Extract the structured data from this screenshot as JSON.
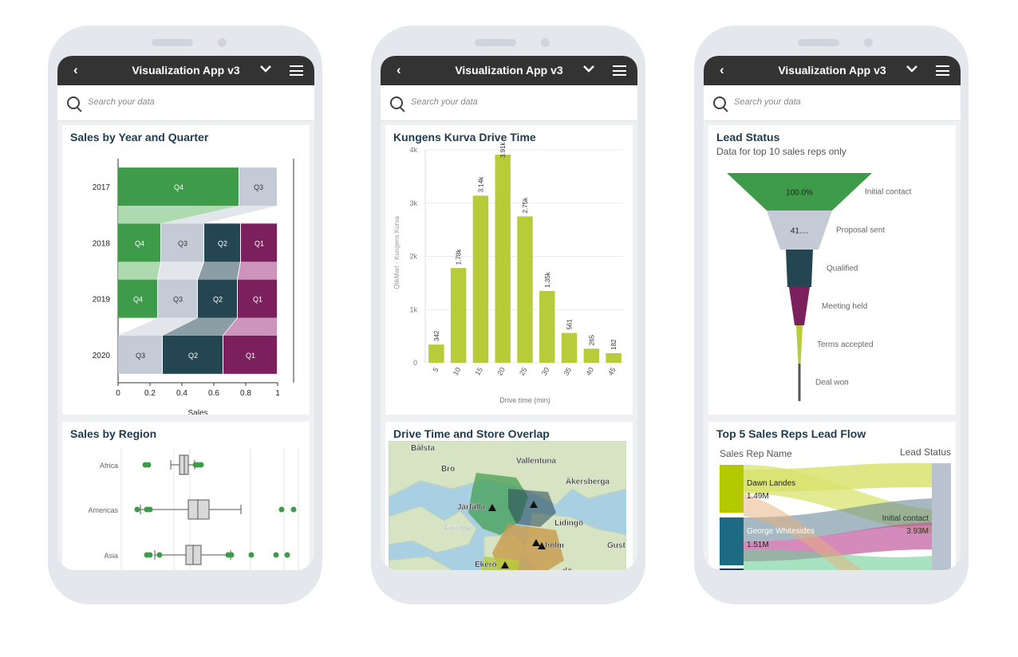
{
  "app": {
    "title": "Visualization App v3",
    "back_icon": "‹",
    "dropdown_icon": "⌄"
  },
  "search": {
    "placeholder": "Search your data"
  },
  "colors": {
    "green": "#3d9b49",
    "light_green": "#a5d6a7",
    "grey": "#c4cbd6",
    "navy": "#244653",
    "purple": "#7b1f5d",
    "lime": "#b8cc3a"
  },
  "phone1": {
    "card1_title": "Sales by Year and Quarter",
    "card1_xlabel": "Sales",
    "card1_xticks": [
      "0",
      "0.2",
      "0.4",
      "0.6",
      "0.8",
      "1"
    ],
    "card2_title": "Sales by Region"
  },
  "phone2": {
    "card1_title": "Kungens Kurva Drive Time",
    "card1_xlabel": "Drive time (min)",
    "card1_ylabel": "QlikMart - Kungens Kurva",
    "card1_yticks": [
      "0",
      "1k",
      "2k",
      "3k",
      "4k"
    ],
    "card2_title": "Drive Time and Store Overlap",
    "map_labels": [
      "Bålsta",
      "Bro",
      "Vallentuna",
      "Åkersberga",
      "Järfälla",
      "Lidingö",
      "Färingsö",
      "Ekerö",
      "Gust",
      "holm",
      "dö"
    ]
  },
  "phone3": {
    "card1_title": "Lead Status",
    "card1_subtitle": "Data for top 10 sales reps only",
    "funnel": [
      {
        "label": "Initial contact",
        "value_label": "100.0%"
      },
      {
        "label": "Proposal sent",
        "value_label": "41...."
      },
      {
        "label": "Qualified",
        "value_label": ""
      },
      {
        "label": "Meeting held",
        "value_label": ""
      },
      {
        "label": "Terms accepted",
        "value_label": ""
      },
      {
        "label": "Deal won",
        "value_label": ""
      }
    ],
    "card2_title": "Top 5 Sales Reps Lead Flow",
    "card2_left_header": "Sales Rep Name",
    "card2_right_header": "Lead Status",
    "rep1_name": "Dawn Landes",
    "rep1_value": "1.49M",
    "rep2_name": "George Whitesides",
    "rep2_value": "1.51M",
    "target_name": "Initial contact",
    "target_value": "3.93M"
  },
  "chart_data": [
    {
      "type": "bar",
      "title": "Sales by Year and Quarter",
      "orientation": "horizontal-stacked",
      "xlabel": "Sales",
      "xlim": [
        0,
        1
      ],
      "categories": [
        "2017",
        "2018",
        "2019",
        "2020"
      ],
      "segments": [
        [
          {
            "name": "Q4",
            "value": 0.76
          },
          {
            "name": "Q3",
            "value": 0.24
          }
        ],
        [
          {
            "name": "Q4",
            "value": 0.27
          },
          {
            "name": "Q3",
            "value": 0.27
          },
          {
            "name": "Q2",
            "value": 0.23
          },
          {
            "name": "Q1",
            "value": 0.23
          }
        ],
        [
          {
            "name": "Q4",
            "value": 0.25
          },
          {
            "name": "Q3",
            "value": 0.25
          },
          {
            "name": "Q2",
            "value": 0.25
          },
          {
            "name": "Q1",
            "value": 0.25
          }
        ],
        [
          {
            "name": "Q3",
            "value": 0.28
          },
          {
            "name": "Q2",
            "value": 0.38
          },
          {
            "name": "Q1",
            "value": 0.34
          }
        ]
      ]
    },
    {
      "type": "box",
      "title": "Sales by Region",
      "categories": [
        "Africa",
        "Americas",
        "Asia"
      ]
    },
    {
      "type": "bar",
      "title": "Kungens Kurva Drive Time",
      "xlabel": "Drive time (min)",
      "ylabel": "QlikMart - Kungens Kurva",
      "ylim": [
        0,
        4000
      ],
      "categories": [
        "5",
        "10",
        "15",
        "20",
        "25",
        "30",
        "35",
        "40",
        "45"
      ],
      "values": [
        342,
        1780,
        3140,
        3910,
        2750,
        1350,
        561,
        265,
        182
      ],
      "value_labels": [
        "342",
        "1.78k",
        "3.14k",
        "3.91k",
        "2.75k",
        "1.35k",
        "561",
        "265",
        "182"
      ]
    },
    {
      "type": "funnel",
      "title": "Lead Status",
      "categories": [
        "Initial contact",
        "Proposal sent",
        "Qualified",
        "Meeting held",
        "Terms accepted",
        "Deal won"
      ]
    }
  ]
}
